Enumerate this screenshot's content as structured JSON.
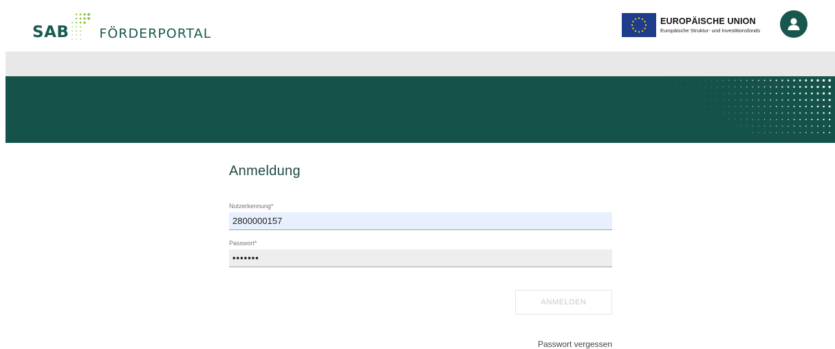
{
  "header": {
    "logo_brand": "SAB",
    "logo_product": "FÖRDERPORTAL",
    "eu_title": "EUROPÄISCHE UNION",
    "eu_subtitle": "Europäische Struktur- und Investitionsfonds",
    "avatar_icon": "user-icon"
  },
  "colors": {
    "brand_green": "#14524a",
    "accent_dots": "#8dc63f",
    "eu_blue": "#1f3c8a",
    "eu_star": "#ffcc00",
    "gray_bar": "#e8e8e8"
  },
  "login": {
    "title": "Anmeldung",
    "username_label": "Nutzerkennung*",
    "username_value": "2800000157",
    "password_label": "Passwort*",
    "password_value": "•••••••",
    "submit_label": "ANMELDEN",
    "forgot_label": "Passwort vergessen"
  }
}
